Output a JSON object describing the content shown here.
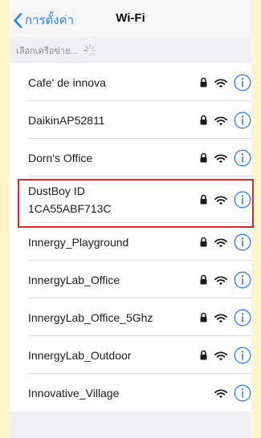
{
  "navbar": {
    "back_label": "การตั้งค่า",
    "title": "Wi-Fi"
  },
  "section": {
    "label": "เลือกเครือข่าย..."
  },
  "colors": {
    "accent": "#2f7cf6",
    "highlight": "#e02a2a"
  },
  "networks": [
    {
      "ssid": [
        "Cafe' de innova"
      ],
      "secured": true
    },
    {
      "ssid": [
        "DaikinAP52811"
      ],
      "secured": true
    },
    {
      "ssid": [
        "Dorn's Office"
      ],
      "secured": true
    },
    {
      "ssid": [
        "DustBoy ID",
        "1CA55ABF713C"
      ],
      "secured": true,
      "highlighted": true
    },
    {
      "ssid": [
        "Innergy_Playground"
      ],
      "secured": true
    },
    {
      "ssid": [
        "InnergyLab_Office"
      ],
      "secured": true
    },
    {
      "ssid": [
        "InnergyLab_Office_5Ghz"
      ],
      "secured": true
    },
    {
      "ssid": [
        "InnergyLab_Outdoor"
      ],
      "secured": true
    },
    {
      "ssid": [
        "Innovative_Village"
      ],
      "secured": false
    }
  ]
}
